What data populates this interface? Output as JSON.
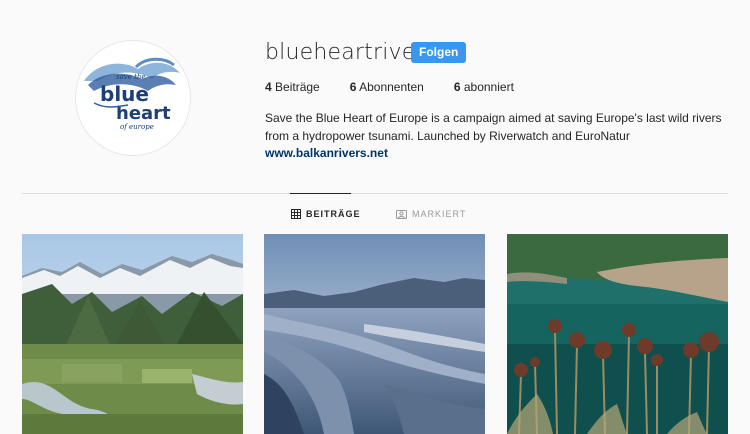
{
  "profile": {
    "username": "blueheartrivers",
    "follow_label": "Folgen",
    "avatar_logo_lines": [
      "save the",
      "blue",
      "heart",
      "of europe"
    ]
  },
  "stats": [
    {
      "count": "4",
      "label": "Beiträge"
    },
    {
      "count": "6",
      "label": "Abonnenten"
    },
    {
      "count": "6",
      "label": "abonniert"
    }
  ],
  "bio": {
    "text": "Save the Blue Heart of Europe is a campaign aimed at saving Europe's last wild rivers from a hydropower tsunami. Launched by Riverwatch and EuroNatur",
    "link": "www.balkanrivers.net"
  },
  "tabs": [
    {
      "label": "BEITRÄGE",
      "icon": "grid-icon",
      "active": true
    },
    {
      "label": "MARKIERT",
      "icon": "tagged-icon",
      "active": false
    }
  ],
  "colors": {
    "accent": "#3897f0",
    "link": "#003569",
    "text": "#262626",
    "muted": "#999999",
    "background": "#fafafa"
  }
}
